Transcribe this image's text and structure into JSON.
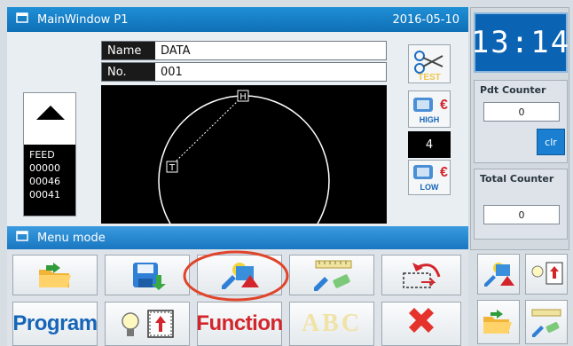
{
  "window": {
    "title": "MainWindow P1",
    "date": "2016-05-10"
  },
  "pattern": {
    "name_label": "Name",
    "name_value": "DATA",
    "no_label": "No.",
    "no_value": "001"
  },
  "canvas": {
    "home_marker": "H",
    "start_marker": "T"
  },
  "feed": {
    "label": "FEED",
    "values": [
      "00000",
      "00046",
      "00041"
    ]
  },
  "tools": {
    "test_label": "TEST",
    "high_label": "HIGH",
    "low_label": "LOW",
    "speed_value": "4"
  },
  "clock": {
    "time": "13:14"
  },
  "counters": {
    "pdt_label": "Pdt Counter",
    "pdt_value": "0",
    "clr_label": "clr",
    "total_label": "Total Counter",
    "total_value": "0"
  },
  "menu": {
    "title": "Menu mode",
    "program_label": "Program",
    "function_label": "Function",
    "abc_label": "ABC"
  },
  "colors": {
    "accent": "#1a7fd0",
    "highlight_circle": "#e0442a",
    "title_bar": "#1f8fd6"
  }
}
